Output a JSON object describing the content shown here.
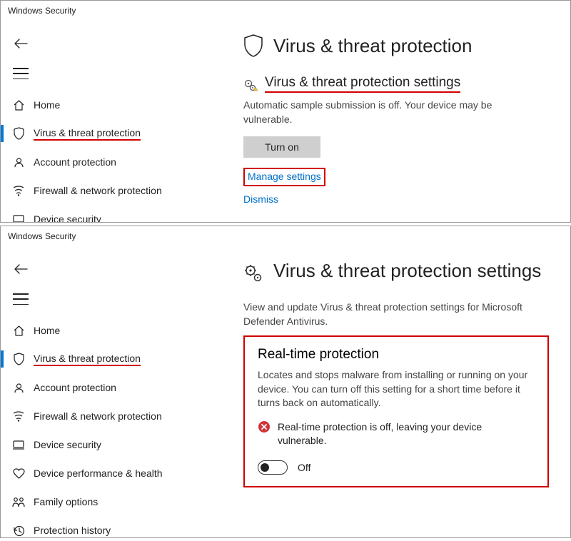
{
  "window1": {
    "title": "Windows Security",
    "nav": [
      {
        "label": "Home"
      },
      {
        "label": "Virus & threat protection"
      },
      {
        "label": "Account protection"
      },
      {
        "label": "Firewall & network protection"
      },
      {
        "label": "Device security"
      }
    ],
    "page": {
      "title": "Virus & threat protection",
      "section_title": "Virus & threat protection settings",
      "body": "Automatic sample submission is off. Your device may be vulnerable.",
      "button": "Turn on",
      "link_manage": "Manage settings",
      "link_dismiss": "Dismiss"
    }
  },
  "window2": {
    "title": "Windows Security",
    "nav": [
      {
        "label": "Home"
      },
      {
        "label": "Virus & threat protection"
      },
      {
        "label": "Account protection"
      },
      {
        "label": "Firewall & network protection"
      },
      {
        "label": "Device security"
      },
      {
        "label": "Device performance & health"
      },
      {
        "label": "Family options"
      },
      {
        "label": "Protection history"
      }
    ],
    "page": {
      "title": "Virus & threat protection settings",
      "subtitle": "View and update Virus & threat protection settings for Microsoft Defender Antivirus.",
      "card": {
        "title": "Real-time protection",
        "body": "Locates and stops malware from installing or running on your device. You can turn off this setting for a short time before it turns back on automatically.",
        "alert": "Real-time protection is off, leaving your device vulnerable.",
        "toggle_label": "Off"
      }
    }
  }
}
